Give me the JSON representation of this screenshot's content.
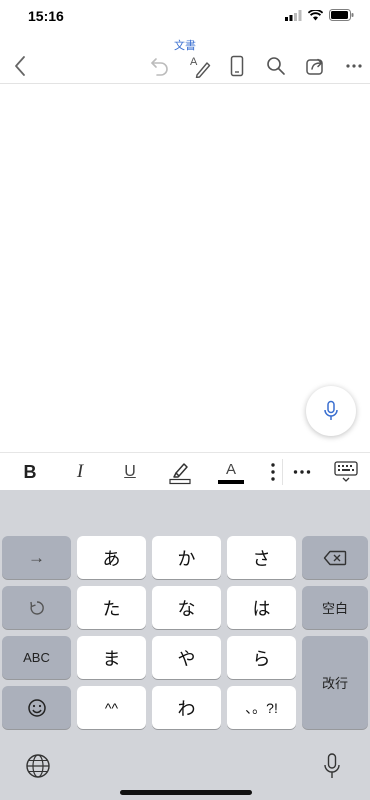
{
  "status_bar": {
    "time": "15:16"
  },
  "header": {
    "title": "文書"
  },
  "toolbar": {
    "icons": [
      "back-icon",
      "undo-icon",
      "text-edit-icon",
      "mobile-view-icon",
      "search-icon",
      "share-icon",
      "more-icon"
    ]
  },
  "format_bar": {
    "bold": "B",
    "italic": "I",
    "underline": "U",
    "font_color_letter": "A",
    "font_color": "#000000"
  },
  "keyboard": {
    "row1": [
      "あ",
      "か",
      "さ"
    ],
    "row2": [
      "た",
      "な",
      "は"
    ],
    "row3": [
      "ま",
      "や",
      "ら"
    ],
    "row4": [
      "^^",
      "わ",
      "、。?!"
    ],
    "left_keys": {
      "arrow": "→",
      "abc": "ABC"
    },
    "space_label": "空白",
    "enter_label": "改行"
  },
  "colors": {
    "accent": "#3a6fd0",
    "keyboard_bg": "#d2d4d9",
    "key_dark": "#abb0bb"
  }
}
